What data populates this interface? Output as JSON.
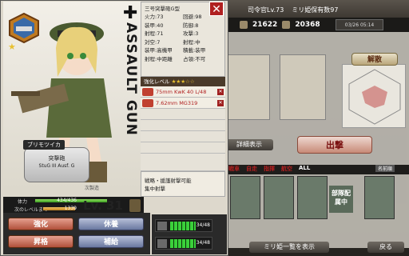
{
  "header": {
    "commander": "司令官Lv.73",
    "owned": "ミリ姫保有数97"
  },
  "resources": {
    "fuel": "21622",
    "ammo": "20368",
    "date": "03/26 05:14"
  },
  "background": {
    "dismiss_label": "解散",
    "detail_label": "詳細表示",
    "sortie_label": "出撃",
    "tabs": [
      "戦車",
      "自走",
      "指揮",
      "航空",
      "ALL"
    ],
    "sort_label": "名前順",
    "deployed_label": "部隊配属中",
    "list_label": "ミリ姫一覧を表示",
    "back_label": "戻る"
  },
  "unit": {
    "class": "三号突撃砲G型",
    "vertical_type": "ASSAULT GUN",
    "name": "ブリモツイカ",
    "name_type": "突撃砲",
    "name_model": "StuG III Ausf. G",
    "production": "次製造",
    "level": "Lv. 31",
    "hp_label": "体力",
    "hp_value": "434/436",
    "exp_label": "次のレベルまで",
    "exp_value": "1339"
  },
  "stats": [
    [
      "火力:73",
      "回避:98"
    ],
    [
      "装甲:40",
      "防御:8"
    ],
    [
      "射程:71",
      "攻撃:3"
    ],
    [
      "対空:7",
      "射程:中"
    ],
    [
      "装甲:高機甲",
      "積載:装甲"
    ],
    [
      "射程:中距離",
      "占領:不可"
    ]
  ],
  "skill": {
    "label": "強化レベル",
    "stars": "★★★☆☆"
  },
  "weapons": [
    "75mm KwK 40 L/48",
    "7.62mm MG319"
  ],
  "abilities": [
    "戦略・援護射撃可能",
    "集中射撃"
  ],
  "buttons": {
    "enhance": "強化",
    "rest": "休養",
    "promote": "昇格",
    "supply": "補給"
  },
  "gauges": [
    {
      "value": "34/48"
    },
    {
      "value": "34/48"
    }
  ],
  "colors": {
    "accent_red": "#b02020",
    "brand_gold": "#e8c030",
    "hp_green": "#3a9a20"
  },
  "icons": {
    "close": "close-icon",
    "lock": "lock-icon",
    "emblem": "tank-emblem-icon"
  }
}
